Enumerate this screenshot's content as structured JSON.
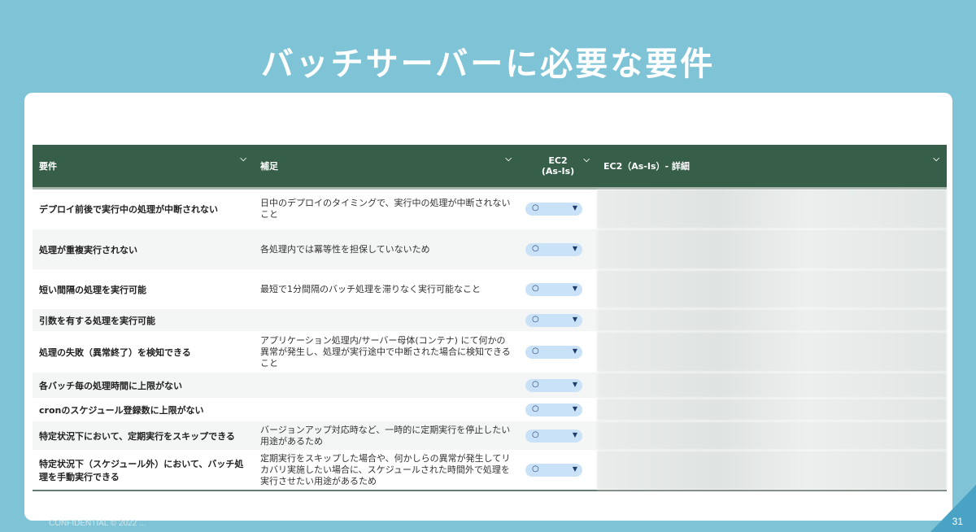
{
  "slide": {
    "title": "バッチサーバーに必要な要件",
    "page_number": "31",
    "footer": "CONFIDENTIAL © 2022 ..."
  },
  "table": {
    "headers": {
      "requirement": "要件",
      "note": "補足",
      "ec2": "EC2\n(As-Is)",
      "detail": "EC2（As-Is）- 詳細"
    },
    "rows": [
      {
        "requirement": "デプロイ前後で実行中の処理が中断されない",
        "note": "日中のデプロイのタイミングで、実行中の処理が中断されないこと",
        "ec2": "○"
      },
      {
        "requirement": "処理が重複実行されない",
        "note": "各処理内では冪等性を担保していないため",
        "ec2": "○"
      },
      {
        "requirement": "短い間隔の処理を実行可能",
        "note": "最短で1分間隔のバッチ処理を滞りなく実行可能なこと",
        "ec2": "○"
      },
      {
        "requirement": "引数を有する処理を実行可能",
        "note": "",
        "ec2": "○"
      },
      {
        "requirement": "処理の失敗（異常終了）を検知できる",
        "note": "アプリケーション処理内/サーバー母体(コンテナ) にて何かの異常が発生し、処理が実行途中で中断された場合に検知できること",
        "ec2": "○"
      },
      {
        "requirement": "各バッチ毎の処理時間に上限がない",
        "note": "",
        "ec2": "○"
      },
      {
        "requirement": "cronのスケジュール登録数に上限がない",
        "note": "",
        "ec2": "○"
      },
      {
        "requirement": "特定状況下において、定期実行をスキップできる",
        "note": "バージョンアップ対応時など、一時的に定期実行を停止したい用途があるため",
        "ec2": "○"
      },
      {
        "requirement": "特定状況下（スケジュール外）において、バッチ処理を手動実行できる",
        "note": "定期実行をスキップした場合や、何かしらの異常が発生してリカバリ実施したい場合に、スケジュールされた時間外で処理を実行させたい用途があるため",
        "ec2": "○"
      }
    ]
  }
}
